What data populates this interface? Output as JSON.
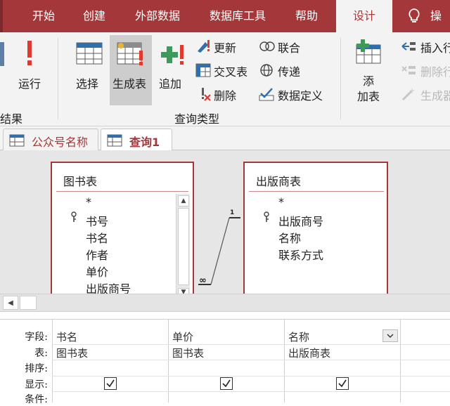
{
  "menu": {
    "items": [
      "开始",
      "创建",
      "外部数据",
      "数据库工具",
      "帮助",
      "设计",
      "操"
    ],
    "active": "设计"
  },
  "ribbon": {
    "results_group": {
      "label_partial": "结果",
      "run_label": "运行"
    },
    "query_type_group": {
      "label": "查询类型",
      "select_label": "选择",
      "make_table_label": "生成表",
      "append_label": "追加",
      "update_label": "更新",
      "crosstab_label": "交叉表",
      "delete_label": "删除",
      "union_label": "联合",
      "passthrough_label": "传递",
      "data_definition_label": "数据定义"
    },
    "setup_group": {
      "add_table_label_line1": "添",
      "add_table_label_line2": "加表",
      "insert_label": "插入行",
      "delete_row_label": "删除行",
      "builder_label": "生成器"
    }
  },
  "tabs": [
    {
      "label": "公众号名称"
    },
    {
      "label": "查询1"
    }
  ],
  "tables": [
    {
      "title": "图书表",
      "fields": [
        "*",
        "书号",
        "书名",
        "作者",
        "单价",
        "出版商号"
      ]
    },
    {
      "title": "出版商表",
      "fields": [
        "*",
        "出版商号",
        "名称",
        "联系方式"
      ]
    }
  ],
  "relationship": {
    "one_side": "1",
    "many_side": "∞"
  },
  "grid": {
    "row_labels": [
      "字段:",
      "表:",
      "排序:",
      "显示:",
      "条件:"
    ],
    "columns": [
      {
        "field": "书名",
        "table": "图书表",
        "show": true
      },
      {
        "field": "单价",
        "table": "图书表",
        "show": true
      },
      {
        "field": "名称",
        "table": "出版商表",
        "show": true
      }
    ]
  },
  "colors": {
    "accent": "#a4373a",
    "ribbon_bg": "#f3f3f3"
  },
  "icons": [
    "run-icon",
    "select-query-icon",
    "make-table-icon",
    "append-icon",
    "update-icon",
    "crosstab-icon",
    "delete-icon",
    "union-icon",
    "passthrough-icon",
    "data-definition-icon",
    "add-table-icon",
    "insert-row-icon",
    "delete-row-icon",
    "builder-icon",
    "lightbulb-icon",
    "table-tab-icon",
    "primary-key-icon"
  ]
}
